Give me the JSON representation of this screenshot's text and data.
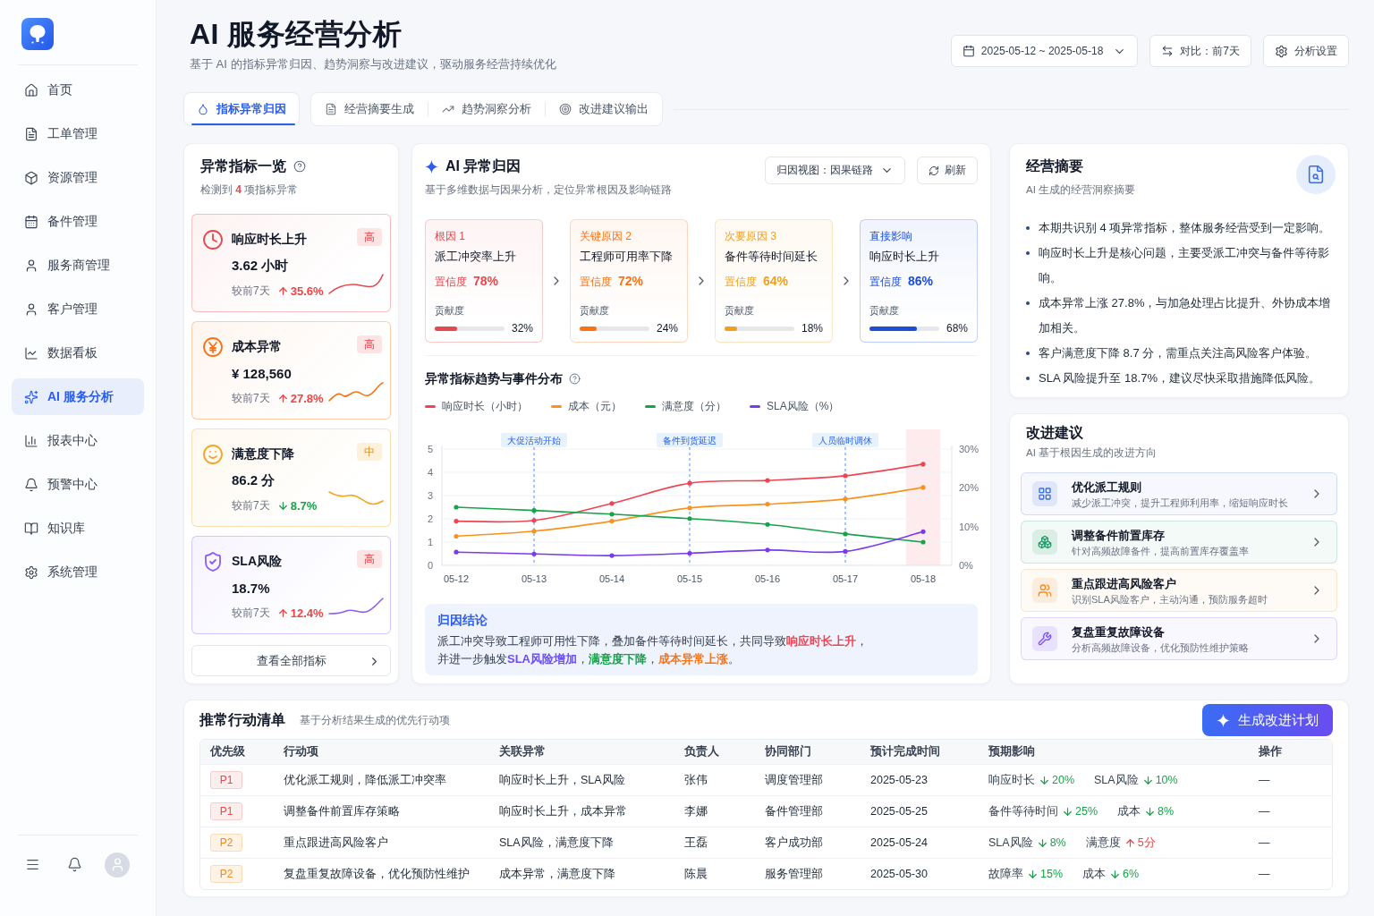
{
  "sidebar": {
    "items": [
      {
        "label": "首页",
        "selected": false
      },
      {
        "label": "工单管理",
        "selected": false
      },
      {
        "label": "资源管理",
        "selected": false
      },
      {
        "label": "备件管理",
        "selected": false
      },
      {
        "label": "服务商管理",
        "selected": false
      },
      {
        "label": "客户管理",
        "selected": false
      },
      {
        "label": "数据看板",
        "selected": false
      },
      {
        "label": "AI 服务分析",
        "selected": true
      },
      {
        "label": "报表中心",
        "selected": false
      },
      {
        "label": "预警中心",
        "selected": false
      },
      {
        "label": "知识库",
        "selected": false
      },
      {
        "label": "系统管理",
        "selected": false
      }
    ]
  },
  "header": {
    "title": "AI 服务经营分析",
    "subtitle": "基于 AI 的指标异常归因、趋势洞察与改进建议，驱动服务经营持续优化",
    "date_range": "2025-05-12 ~ 2025-05-18",
    "compare": "对比：前7天",
    "settings_button": "分析设置"
  },
  "tabs": [
    {
      "label": "指标异常归因",
      "selected": true
    },
    {
      "label": "经营摘要生成",
      "selected": false
    },
    {
      "label": "趋势洞察分析",
      "selected": false
    },
    {
      "label": "改进建议输出",
      "selected": false
    }
  ],
  "anomaly_list": {
    "title": "异常指标一览",
    "count_prefix": "检测到",
    "count": "4",
    "count_suffix": "项指标异常",
    "metrics": [
      {
        "name": "响应时长上升",
        "value": "3.62 小时",
        "compare_label": "较前7天",
        "up": true,
        "change": "35.6%",
        "badge": {
          "label": "高",
          "kind": "high"
        },
        "color": "#e5484d"
      },
      {
        "name": "成本异常",
        "value": "¥ 128,560",
        "compare_label": "较前7天",
        "up": true,
        "change": "27.8%",
        "badge": {
          "label": "高",
          "kind": "high"
        },
        "color": "#f97316"
      },
      {
        "name": "满意度下降",
        "value": "86.2 分",
        "compare_label": "较前7天",
        "up": false,
        "change": "8.7%",
        "badge": {
          "label": "中",
          "kind": "medium"
        },
        "color": "#f5a524"
      },
      {
        "name": "SLA风险",
        "value": "18.7%",
        "compare_label": "较前7天",
        "up": true,
        "change": "12.4%",
        "badge": {
          "label": "高",
          "kind": "high"
        },
        "color": "#8b5cf6"
      }
    ],
    "view_all_button": "查看全部指标"
  },
  "attribution": {
    "title": "AI 异常归因",
    "subtitle": "基于多维数据与因果分析，定位异常根因及影响链路",
    "view_select": "归因视图：因果链路",
    "refresh_button": "刷新",
    "chain": [
      {
        "tag": "根因 1",
        "title": "派工冲突率上升",
        "confidence_label": "置信度",
        "confidence": "78%",
        "contribution_label": "贡献度",
        "level": 0.32,
        "reading": "32%",
        "color": "#e5484d"
      },
      {
        "tag": "关键原因 2",
        "title": "工程师可用率下降",
        "confidence_label": "置信度",
        "confidence": "72%",
        "contribution_label": "贡献度",
        "level": 0.24,
        "reading": "24%",
        "color": "#f97316"
      },
      {
        "tag": "次要原因 3",
        "title": "备件等待时间延长",
        "confidence_label": "置信度",
        "confidence": "64%",
        "contribution_label": "贡献度",
        "level": 0.18,
        "reading": "18%",
        "color": "#f0a020"
      },
      {
        "tag": "直接影响",
        "title": "响应时长上升",
        "confidence_label": "置信度",
        "confidence": "86%",
        "contribution_label": "贡献度",
        "level": 0.68,
        "reading": "68%",
        "color": "#1d4ed8"
      }
    ],
    "trend": {
      "title": "异常指标趋势与事件分布",
      "chart_data": {
        "type": "line",
        "categories": [
          "05-12",
          "05-13",
          "05-14",
          "05-15",
          "05-16",
          "05-17",
          "05-18"
        ],
        "series": [
          {
            "name": "响应时长（小时）",
            "color": "#ef4452",
            "values": [
              1.9,
              1.93,
              2.66,
              3.53,
              3.65,
              3.85,
              4.35
            ]
          },
          {
            "name": "成本（元）",
            "color": "#f7931e",
            "values": [
              1.25,
              1.47,
              1.9,
              2.47,
              2.63,
              2.85,
              3.35
            ]
          },
          {
            "name": "满意度（分）",
            "color": "#16a34a",
            "values": [
              2.5,
              2.36,
              2.2,
              2.01,
              1.76,
              1.35,
              1.0
            ]
          },
          {
            "name": "SLA风险（%）",
            "color": "#7c3aed",
            "values": [
              0.57,
              0.49,
              0.42,
              0.52,
              0.66,
              0.6,
              1.45
            ]
          }
        ],
        "ylim": [
          0,
          5
        ],
        "yticks": [
          {
            "value": 0,
            "label": "0"
          },
          {
            "value": 1,
            "label": "1"
          },
          {
            "value": 2,
            "label": "2"
          },
          {
            "value": 3,
            "label": "3"
          },
          {
            "value": 4,
            "label": "4"
          },
          {
            "value": 5,
            "label": "5"
          }
        ],
        "y2lim": [
          0,
          30
        ],
        "y2ticks": [
          {
            "value": 0,
            "label": "0%"
          },
          {
            "value": 10,
            "label": "10%"
          },
          {
            "value": 20,
            "label": "20%"
          },
          {
            "value": 30,
            "label": "30%"
          }
        ],
        "grid": true,
        "ref_lines": [
          {
            "axis": "x",
            "value": "05-13",
            "label": "大促活动开始"
          },
          {
            "axis": "x",
            "value": "05-15",
            "label": "备件到货延迟"
          },
          {
            "axis": "x",
            "value": "05-17",
            "label": "人员临时调休"
          }
        ],
        "bands": [
          {
            "axis": "x",
            "from": "05-18",
            "to": "05-18"
          }
        ]
      }
    },
    "conclusion": {
      "title": "归因结论",
      "lines": [
        [
          {
            "text": "派工冲突导致工程师可用性下降，叠加备件等待时间延长，共同导致"
          },
          {
            "text": "响应时长上升",
            "color": "#ef4452"
          },
          {
            "text": "，"
          }
        ],
        [
          {
            "text": "并进一步触发"
          },
          {
            "text": "SLA风险增加",
            "color": "#6d4aff"
          },
          {
            "text": "，"
          },
          {
            "text": "满意度下降",
            "color": "#16a34a"
          },
          {
            "text": "，"
          },
          {
            "text": "成本异常上涨",
            "color": "#f97316"
          },
          {
            "text": "。"
          }
        ]
      ]
    }
  },
  "summary": {
    "title": "经营摘要",
    "subtitle": "AI 生成的经营洞察摘要",
    "bullets": [
      "本期共识别 4 项异常指标，整体服务经营受到一定影响。",
      "响应时长上升是核心问题，主要受派工冲突与备件等待影响。",
      "成本异常上涨 27.8%，与加急处理占比提升、外协成本增加相关。",
      "客户满意度下降 8.7 分，需重点关注高风险客户体验。",
      "SLA 风险提升至 18.7%，建议尽快采取措施降低风险。"
    ]
  },
  "suggestions": {
    "title": "改进建议",
    "subtitle": "AI 基于根因生成的改进方向",
    "items": [
      {
        "title": "优化派工规则",
        "description": "减少派工冲突，提升工程师利用率，缩短响应时长",
        "color": "#3b6fe0"
      },
      {
        "title": "调整备件前置库存",
        "description": "针对高频故障备件，提高前置库存覆盖率",
        "color": "#1f9d6a"
      },
      {
        "title": "重点跟进高风险客户",
        "description": "识别SLA风险客户，主动沟通，预防服务超时",
        "color": "#f08c2a"
      },
      {
        "title": "复盘重复故障设备",
        "description": "分析高频故障设备，优化预防性维护策略",
        "color": "#7c4dff"
      }
    ]
  },
  "action_plan": {
    "title": "推常行动清单",
    "subtitle": "基于分析结果生成的优先行动项",
    "generate_button": "生成改进计划",
    "columns": [
      "优先级",
      "行动项",
      "关联异常",
      "负责人",
      "协同部门",
      "预计完成时间",
      "预期影响",
      "操作"
    ],
    "rows": [
      {
        "priority": {
          "label": "P1",
          "kind": "high"
        },
        "action": "优化派工规则，降低派工冲突率",
        "related": "响应时长上升，SLA风险",
        "owner": "张伟",
        "department": "调度管理部",
        "due": "2025-05-23",
        "impacts": [
          {
            "label": "响应时长",
            "up": false,
            "value": "20%"
          },
          {
            "label": "SLA风险",
            "up": false,
            "value": "10%"
          }
        ],
        "operation": "—"
      },
      {
        "priority": {
          "label": "P1",
          "kind": "high"
        },
        "action": "调整备件前置库存策略",
        "related": "响应时长上升，成本异常",
        "owner": "李娜",
        "department": "备件管理部",
        "due": "2025-05-25",
        "impacts": [
          {
            "label": "备件等待时间",
            "up": false,
            "value": "25%"
          },
          {
            "label": "成本",
            "up": false,
            "value": "8%"
          }
        ],
        "operation": "—"
      },
      {
        "priority": {
          "label": "P2",
          "kind": "medium"
        },
        "action": "重点跟进高风险客户",
        "related": "SLA风险，满意度下降",
        "owner": "王磊",
        "department": "客户成功部",
        "due": "2025-05-24",
        "impacts": [
          {
            "label": "SLA风险",
            "up": false,
            "value": "8%"
          },
          {
            "label": "满意度",
            "up": true,
            "value": "5分"
          }
        ],
        "operation": "—"
      },
      {
        "priority": {
          "label": "P2",
          "kind": "medium"
        },
        "action": "复盘重复故障设备，优化预防性维护",
        "related": "成本异常，满意度下降",
        "owner": "陈晨",
        "department": "服务管理部",
        "due": "2025-05-30",
        "impacts": [
          {
            "label": "故障率",
            "up": false,
            "value": "15%"
          },
          {
            "label": "成本",
            "up": false,
            "value": "6%"
          }
        ],
        "operation": "—"
      }
    ]
  }
}
